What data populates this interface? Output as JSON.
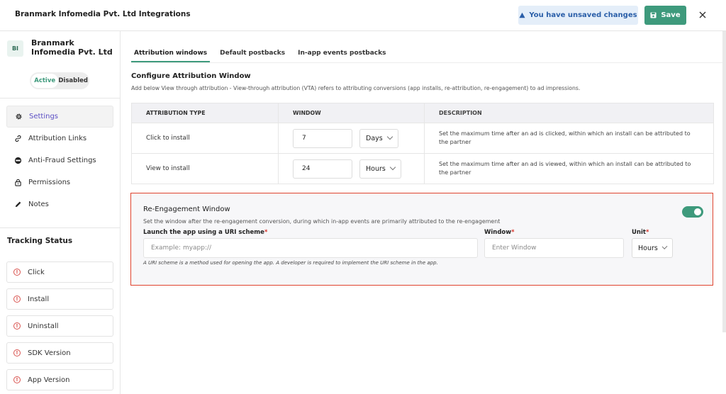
{
  "header": {
    "title": "Branmark Infomedia Pvt. Ltd Integrations",
    "unsaved_label": "You have unsaved changes",
    "save_label": "Save"
  },
  "sidebar": {
    "avatar": "BI",
    "brand_name": "Branmark Infomedia Pvt. Ltd",
    "status_active": "Active",
    "status_disabled": "Disabled",
    "nav": [
      {
        "label": "Settings",
        "icon": "gear-icon",
        "selected": true
      },
      {
        "label": "Attribution Links",
        "icon": "link-icon"
      },
      {
        "label": "Anti-Fraud Settings",
        "icon": "shield-icon"
      },
      {
        "label": "Permissions",
        "icon": "lock-icon"
      },
      {
        "label": "Notes",
        "icon": "pencil-icon"
      }
    ],
    "tracking_title": "Tracking Status",
    "tracking": [
      {
        "label": "Click"
      },
      {
        "label": "Install"
      },
      {
        "label": "Uninstall"
      },
      {
        "label": "SDK Version"
      },
      {
        "label": "App Version"
      }
    ]
  },
  "tabs": [
    "Attribution windows",
    "Default postbacks",
    "In-app events postbacks"
  ],
  "configure": {
    "title": "Configure Attribution Window",
    "description": "Add below View through attribution - View-through attribution (VTA) refers to attributing conversions (app installs, re-attribution, re-engagement) to ad impressions."
  },
  "table": {
    "headers": [
      "ATTRIBUTION TYPE",
      "WINDOW",
      "DESCRIPTION"
    ],
    "rows": [
      {
        "type": "Click to install",
        "value": "7",
        "unit": "Days",
        "description": "Set the maximum time after an ad is clicked, within which an install can be attributed to the partner"
      },
      {
        "type": "View to install",
        "value": "24",
        "unit": "Hours",
        "description": "Set the maximum time after an ad is viewed, within which an install can be attributed to the partner"
      }
    ]
  },
  "reengagement": {
    "title": "Re-Engagement Window",
    "description": "Set the window after the re-engagement conversion, during which in-app events are primarily attributed to the re-engagement",
    "enabled": true,
    "uri_label": "Launch the app using a URI scheme",
    "uri_placeholder": "Example: myapp://",
    "window_label": "Window",
    "window_placeholder": "Enter Window",
    "unit_label": "Unit",
    "unit_value": "Hours",
    "required_mark": "*",
    "hint": "A URI scheme is a method used for opening the app. A developer is required to implement the URI scheme in the app."
  },
  "colors": {
    "accent": "#3e9a7c",
    "alert": "#e0432e",
    "info": "#2a5ea8",
    "nav_selected": "#5b4fc4"
  }
}
